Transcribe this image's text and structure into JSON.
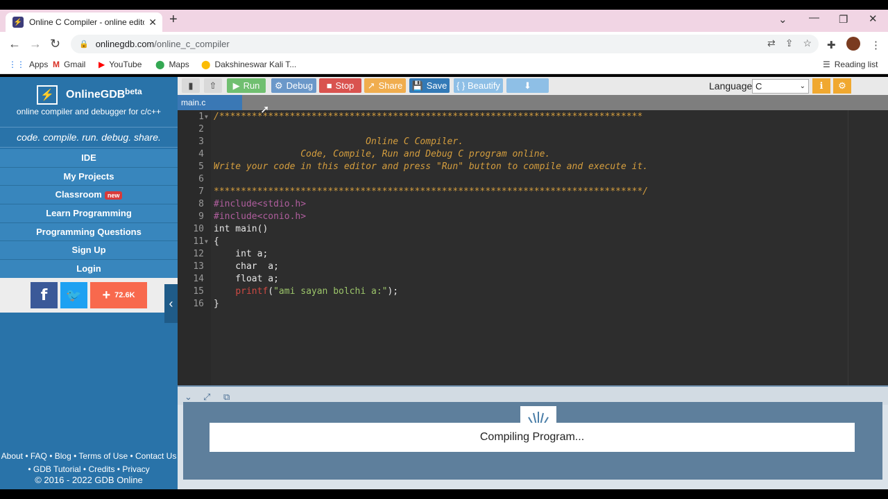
{
  "browser": {
    "tab_title": "Online C Compiler - online editor",
    "url_domain": "onlinegdb.com",
    "url_path": "/online_c_compiler",
    "bookmarks": [
      "Apps",
      "Gmail",
      "YouTube",
      "Maps",
      "Dakshineswar Kali T..."
    ],
    "reading_list": "Reading list"
  },
  "sidebar": {
    "brand": "OnlineGDB",
    "beta": "beta",
    "subtitle": "online compiler and debugger for c/c++",
    "tagline": "code. compile. run. debug. share.",
    "menu": [
      "IDE",
      "My Projects",
      "Classroom",
      "Learn Programming",
      "Programming Questions",
      "Sign Up",
      "Login"
    ],
    "classroom_badge": "new",
    "share_count": "72.6K",
    "footer_line1": "About • FAQ • Blog • Terms of Use • Contact Us",
    "footer_line2": "• GDB Tutorial • Credits • Privacy",
    "copyright": "© 2016 - 2022 GDB Online"
  },
  "toolbar": {
    "run": "Run",
    "debug": "Debug",
    "stop": "Stop",
    "share": "Share",
    "save": "Save",
    "beautify": "{ } Beautify",
    "language_label": "Language",
    "language_value": "C"
  },
  "editor": {
    "file_tab": "main.c",
    "line_numbers": [
      "1",
      "2",
      "3",
      "4",
      "5",
      "6",
      "7",
      "8",
      "9",
      "10",
      "11",
      "12",
      "13",
      "14",
      "15",
      "16"
    ],
    "lines": {
      "l1": "/******************************************************************************",
      "l3": "                            Online C Compiler.",
      "l4": "                Code, Compile, Run and Debug C program online.",
      "l5": "Write your code in this editor and press \"Run\" button to compile and execute it.",
      "l7": "*******************************************************************************/",
      "l8_pp": "#include",
      "l8_hdr": "<stdio.h>",
      "l9_pp": "#include",
      "l9_hdr": "<conio.h>",
      "l10": "int main()",
      "l11": "{",
      "l12": "    int a;",
      "l13": "    char  a;",
      "l14": "    float a;",
      "l15_indent": "    ",
      "l15_fn": "printf",
      "l15_open": "(",
      "l15_str": "\"ami sayan bolchi a:\"",
      "l15_close": ");",
      "l16": "}"
    }
  },
  "output": {
    "status": "Compiling Program..."
  },
  "colors": {
    "sidebar": "#2973a9",
    "run": "#4cae4c",
    "debug": "#5b8fc7",
    "stop": "#d9534f",
    "share": "#f0ad4e",
    "save": "#337ab7",
    "beautify": "#8ebfe6"
  }
}
